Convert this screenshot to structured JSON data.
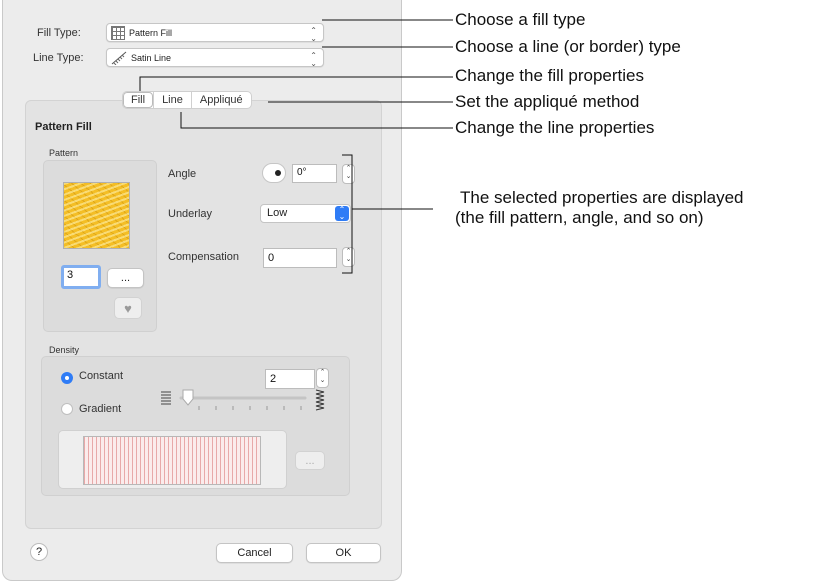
{
  "dialog": {
    "fill_type_label": "Fill Type:",
    "fill_type_value": "Pattern Fill",
    "line_type_label": "Line Type:",
    "line_type_value": "Satin Line",
    "tabs": [
      {
        "label": "Fill"
      },
      {
        "label": "Line"
      },
      {
        "label": "Appliqué"
      }
    ],
    "section_title": "Pattern Fill",
    "pattern_group_label": "Pattern",
    "pattern_number": "3",
    "ellipsis_label": "...",
    "angle_label": "Angle",
    "angle_value": "0°",
    "underlay_label": "Underlay",
    "underlay_value": "Low",
    "compensation_label": "Compensation",
    "compensation_value": "0",
    "density_group_label": "Density",
    "constant_label": "Constant",
    "gradient_label": "Gradient",
    "density_value": "2",
    "density_ellipsis": "...",
    "help_label": "?",
    "cancel_label": "Cancel",
    "ok_label": "OK"
  },
  "annotations": {
    "fill_type": "Choose a fill type",
    "line_type": "Choose a line (or border) type",
    "fill_props": "Change the fill properties",
    "applique": "Set the appliqué method",
    "line_props": "Change the line properties",
    "selected_line1": "The selected properties are displayed",
    "selected_line2": "(the fill pattern, angle, and so on)"
  },
  "colors": {
    "accent": "#2f7cf6",
    "pattern_swatch": "#f4be25",
    "density_lines": "#e8a9a9",
    "focus_ring": "#80aef0"
  }
}
